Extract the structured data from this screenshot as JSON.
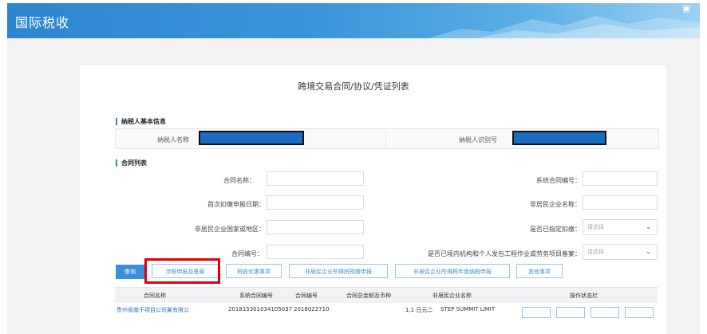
{
  "header": {
    "title": "国际税收"
  },
  "page": {
    "title": "跨境交易合同/协议/凭证列表"
  },
  "sections": {
    "basic_info": "纳税人基本信息",
    "contract_list": "合同列表"
  },
  "basic_info": {
    "taxpayer_name_label": "纳税人名称",
    "taxpayer_id_label": "纳税人识别号",
    "redaction_color": "#1a6cc0"
  },
  "filters": {
    "contract_name": "合同名称：",
    "system_contract_no": "系统合同编号：",
    "first_withholding_date": "首次扣缴申报日期：",
    "nonresident_name": "非居民企业名称：",
    "nonresident_country": "非居民企业国家或地区：",
    "designated_withholding": "是否已指定扣缴：",
    "contract_no": "合同编号：",
    "filed_domestic": "是否已境内机构和个人发包工程作业或劳务项目备案：",
    "select_placeholder": "请选择"
  },
  "buttons": {
    "query": "查询",
    "tax_filing": "涉税申报及备案",
    "tax_preference": "税收优惠事项",
    "prepaid_filing": "非居民企业所得税预缴申报",
    "annual_filing": "非居民企业所得税年度纳税申报",
    "other": "其他事项"
  },
  "table": {
    "columns": [
      "合同名称",
      "系统合同编号",
      "合同编号",
      "合同总金额及币种",
      "非居民企业名称",
      "操作状态栏"
    ],
    "rows": [
      {
        "name": "贵州省南于项目公司某有限公",
        "system_no": "201815301034105037",
        "contract_no": "2018022710",
        "amount": "1,1 日元二",
        "nonresident": "STEP SUMMIT LIMIT"
      }
    ]
  },
  "colors": {
    "accent": "#2d86cf",
    "highlight": "#e0000d"
  }
}
